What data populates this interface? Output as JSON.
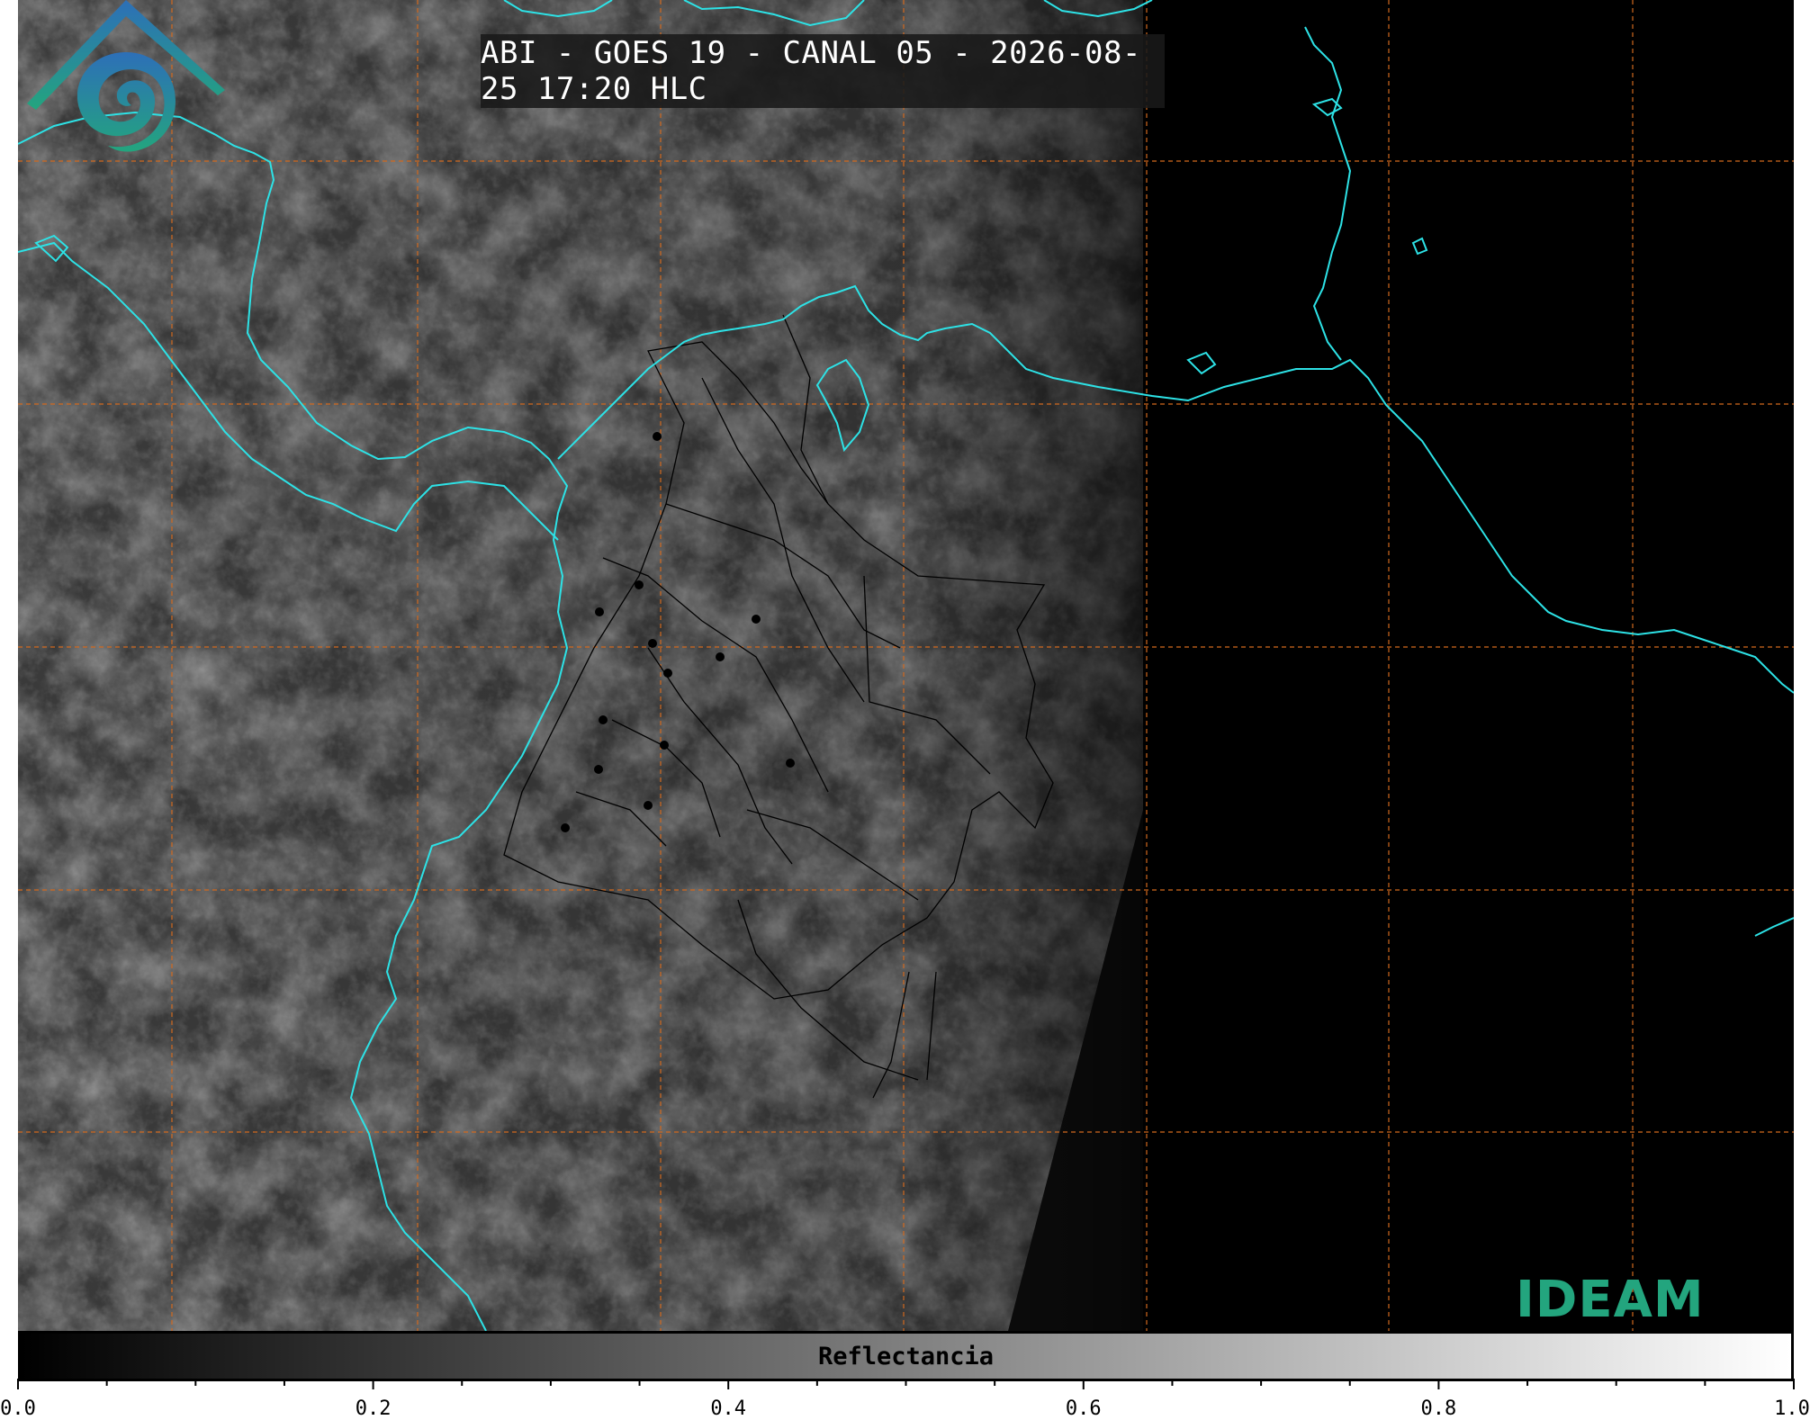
{
  "title": "ABI - GOES 19 - CANAL 05 - 2026-08-25 17:20 HLC",
  "logo": {
    "text": "IDEAM",
    "icon": "ideam-logo-icon"
  },
  "colorbar": {
    "label": "Reflectancia",
    "min": 0.0,
    "max": 1.0,
    "tick_labels": [
      "0.0",
      "0.2",
      "0.4",
      "0.6",
      "0.8",
      "1.0"
    ],
    "colors": [
      "#000000",
      "#ffffff"
    ]
  },
  "colors": {
    "coastline": "#2de2e6",
    "graticule": "#d2691e",
    "borders": "#000000"
  }
}
